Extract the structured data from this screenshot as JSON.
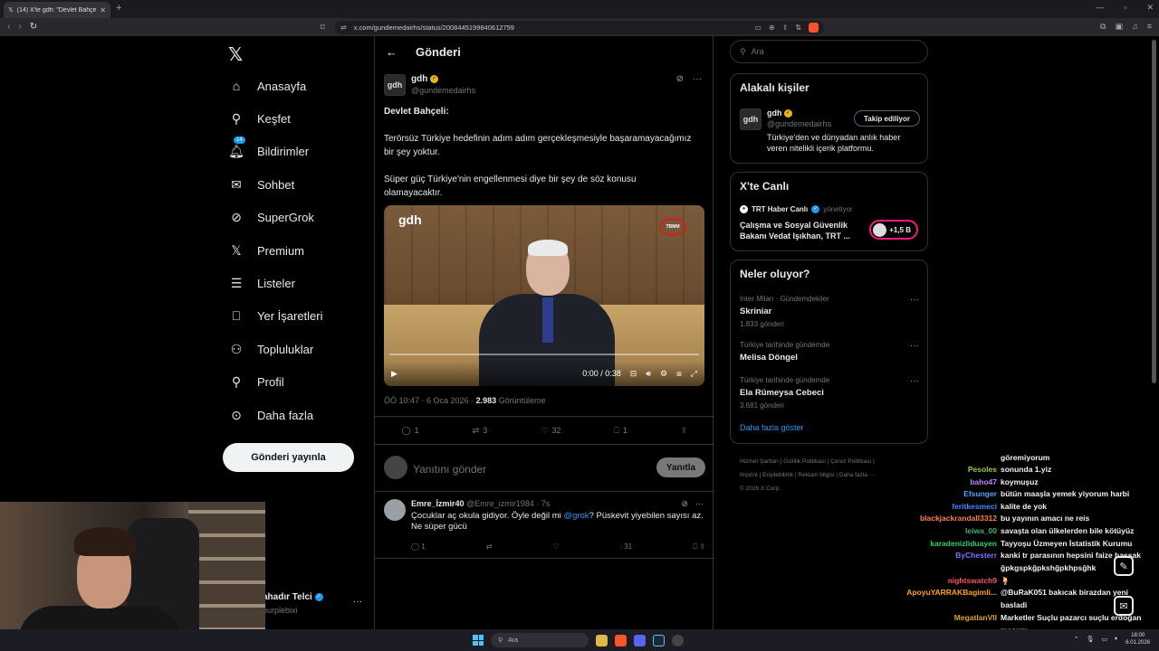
{
  "browser": {
    "tab_title": "(14) X'te gdh: \"Devlet Bahçeli: Te...",
    "url": "x.com/gundemedairhs/status/2008445199840612759"
  },
  "nav": {
    "items": [
      {
        "label": "Anasayfa",
        "icon": "home-icon"
      },
      {
        "label": "Keşfet",
        "icon": "search-icon"
      },
      {
        "label": "Bildirimler",
        "icon": "bell-icon",
        "badge": "14"
      },
      {
        "label": "Sohbet",
        "icon": "mail-icon"
      },
      {
        "label": "SuperGrok",
        "icon": "grok-icon"
      },
      {
        "label": "Premium",
        "icon": "x-icon"
      },
      {
        "label": "Listeler",
        "icon": "list-icon"
      },
      {
        "label": "Yer İşaretleri",
        "icon": "bookmark-icon"
      },
      {
        "label": "Topluluklar",
        "icon": "people-icon"
      },
      {
        "label": "Profil",
        "icon": "person-icon"
      },
      {
        "label": "Daha fazla",
        "icon": "more-circle-icon"
      }
    ],
    "post_button": "Gönderi yayınla",
    "account_name": "ahadır Telci",
    "account_handle": "purplebixi"
  },
  "main": {
    "header": "Gönderi",
    "author_name": "gdh",
    "author_handle": "@gundemedairhs",
    "avatar_text": "gdh",
    "text_bold": "Devlet Bahçeli:",
    "text_p1": "Terörsüz Türkiye hedefinin adım adım gerçekleşmesiyle başaramayacağımız bir şey yoktur.",
    "text_p2": "Süper güç Türkiye'nin engellenmesi diye bir şey de söz konusu olamayacaktır.",
    "video_logo": "gdh",
    "video_badge": "TBMM",
    "video_time": "0:00 / 0:38",
    "video_progress": 0,
    "meta_time": "ÖÖ 10:47 · 6 Oca 2026 ·",
    "meta_views": "2.983",
    "meta_views_label": "Görüntüleme",
    "stats": {
      "replies": "1",
      "reposts": "3",
      "likes": "32",
      "bookmarks": "1"
    },
    "reply_placeholder": "Yanıtını gönder",
    "reply_button": "Yanıtla",
    "comment": {
      "name": "Emre_İzmir40",
      "handle": "@Emre_izmir1984 · 7s",
      "text_before": "Çocuklar aç okula gidiyor. Öyle değil mi ",
      "mention": "@grok",
      "text_after": "? Püskevit yiyebilen sayısı az. Ne süper gücü",
      "replies": "1",
      "views": "31"
    }
  },
  "right": {
    "search_placeholder": "Ara",
    "related_title": "Alakalı kişiler",
    "related_name": "gdh",
    "related_handle": "@gundemedairhs",
    "related_desc": "Türkiye'den ve dünyadan anlık haber veren nitelikli içerik platformu.",
    "follow_label": "Takip ediliyor",
    "live_title": "X'te Canlı",
    "live_host": "TRT Haber Canlı",
    "live_host_role": "yönetiyor",
    "live_text": "Çalışma ve Sosyal Güvenlik Bakanı Vedat Işıkhan, TRT ...",
    "live_count": "+1,5 B",
    "trends_title": "Neler oluyor?",
    "trends": [
      {
        "context": "Inter Milan · Gündemdekiler",
        "topic": "Skriniar",
        "count": "1.833 gönderi"
      },
      {
        "context": "Türkiye tarihinde gündemde",
        "topic": "Melisa Döngel",
        "count": ""
      },
      {
        "context": "Türkiye tarihinde gündemde",
        "topic": "Ela Rümeysa Cebeci",
        "count": "3.681 gönderi"
      }
    ],
    "show_more": "Daha fazla göster",
    "footer_line1": "Hizmet Şartları  |  Gizlilik Politikası  |  Çerez Politikası  |",
    "footer_line2": "Imprint  |  Erişilebilirlik  |  Reklam bilgisi  |  Daha fazla ···",
    "footer_line3": "© 2026 X Corp."
  },
  "chat": [
    {
      "user": "",
      "msg": "göremiyorum",
      "color": "#ffffff"
    },
    {
      "user": "Pesoles",
      "msg": "sonunda 1.yiz",
      "color": "#9acd32"
    },
    {
      "user": "baho47",
      "msg": "koymuşuz",
      "color": "#b987ff"
    },
    {
      "user": "Efsunger",
      "msg": "bütün maaşla yemek yiyorum harbi",
      "color": "#4fa3ff"
    },
    {
      "user": "feritkesmeci",
      "msg": "kalite de yok",
      "color": "#3c8cff"
    },
    {
      "user": "blackjackrandall3312",
      "msg": "bu yayının amacı ne reis",
      "color": "#ff7f50"
    },
    {
      "user": "leiwa_00",
      "msg": "savaşta olan ülkelerden bile kötüyüz",
      "color": "#3cb371"
    },
    {
      "user": "karadenizliduayen",
      "msg": "Tayyoşu Üzmeyen İstatistik Kurumu",
      "color": "#2ecc71"
    },
    {
      "user": "ByChesterr",
      "msg": "kanki tr parasının hepsini faize bassak ğpkgspkğpkshğpkhpsğhk",
      "color": "#8a6bff"
    },
    {
      "user": "nightswatch9",
      "msg": "🍹",
      "color": "#ff4d6d"
    },
    {
      "user": "ApoyuYARRAKBagimli...",
      "msg": "@BuRaK051 bakıcak birazdan yeni basladi",
      "color": "#ffa500"
    },
    {
      "user": "MegatlanVII",
      "msg": "Marketler Suçlu pazarcı suçlu erdoğan masum",
      "color": "#daa520"
    },
    {
      "user": "depres11",
      "msg": "🍹",
      "color": "#ff1493"
    }
  ],
  "taskbar": {
    "search_placeholder": "Ara",
    "time": "18:00",
    "date": "6.01.2026"
  }
}
